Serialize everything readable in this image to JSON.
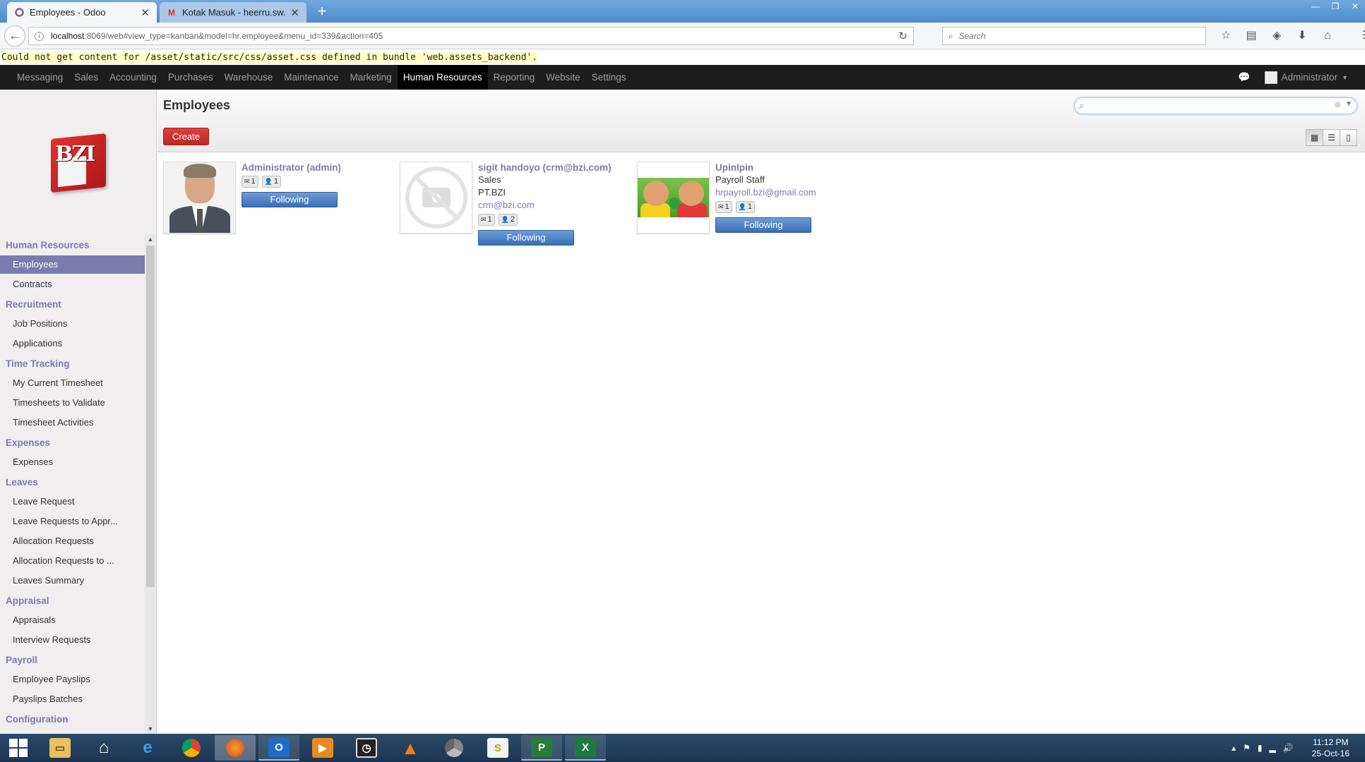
{
  "browser": {
    "tabs": [
      {
        "label": "Employees - Odoo",
        "icon": "odoo-circle-icon",
        "active": true
      },
      {
        "label": "Kotak Masuk - heerru.sw...",
        "icon": "gmail-icon",
        "active": false
      }
    ],
    "url_host": "localhost",
    "url_path": ":8069/web#view_type=kanban&model=hr.employee&menu_id=339&action=405",
    "search_placeholder": "Search"
  },
  "error_message": "Could not get content for /asset/static/src/css/asset.css defined in bundle 'web.assets_backend'.",
  "topmenu": {
    "items": [
      "Messaging",
      "Sales",
      "Accounting",
      "Purchases",
      "Warehouse",
      "Maintenance",
      "Marketing",
      "Human Resources",
      "Reporting",
      "Website",
      "Settings"
    ],
    "active": "Human Resources",
    "user": "Administrator"
  },
  "sidebar": {
    "logo_text": "BZI",
    "sections": [
      {
        "title": "Human Resources",
        "items": [
          "Employees",
          "Contracts"
        ]
      },
      {
        "title": "Recruitment",
        "items": [
          "Job Positions",
          "Applications"
        ]
      },
      {
        "title": "Time Tracking",
        "items": [
          "My Current Timesheet",
          "Timesheets to Validate",
          "Timesheet Activities"
        ]
      },
      {
        "title": "Expenses",
        "items": [
          "Expenses"
        ]
      },
      {
        "title": "Leaves",
        "items": [
          "Leave Request",
          "Leave Requests to Appr...",
          "Allocation Requests",
          "Allocation Requests to ...",
          "Leaves Summary"
        ]
      },
      {
        "title": "Appraisal",
        "items": [
          "Appraisals",
          "Interview Requests"
        ]
      },
      {
        "title": "Payroll",
        "items": [
          "Employee Payslips",
          "Payslips Batches"
        ]
      },
      {
        "title": "Configuration",
        "items": []
      }
    ],
    "active_item": "Employees"
  },
  "main": {
    "title": "Employees",
    "create_label": "Create",
    "search_value": ""
  },
  "employees": [
    {
      "name": "Administrator (admin)",
      "lines": [],
      "email": "",
      "msg_count": "1",
      "follower_count": "1",
      "follow_label": "Following",
      "photo": "man-portrait"
    },
    {
      "name": "sigit handoyo (crm@bzi.com)",
      "lines": [
        "Sales",
        "PT.BZI"
      ],
      "email": "crm@bzi.com",
      "msg_count": "1",
      "follower_count": "2",
      "follow_label": "Following",
      "photo": "no-photo"
    },
    {
      "name": "UpinIpin",
      "lines": [
        "Payroll Staff"
      ],
      "email": "hrpayroll.bzi@gmail.com",
      "msg_count": "1",
      "follower_count": "1",
      "follow_label": "Following",
      "photo": "cartoon-kids"
    }
  ],
  "taskbar": {
    "apps": [
      "file-explorer-icon",
      "home-icon",
      "internet-explorer-icon",
      "chrome-icon",
      "firefox-icon",
      "outlook-icon",
      "media-player-icon",
      "stopwatch-icon",
      "vlc-icon",
      "chromium-icon",
      "sublime-icon",
      "project-icon",
      "excel-icon"
    ],
    "time": "11:12 PM",
    "date": "25-Oct-16"
  }
}
